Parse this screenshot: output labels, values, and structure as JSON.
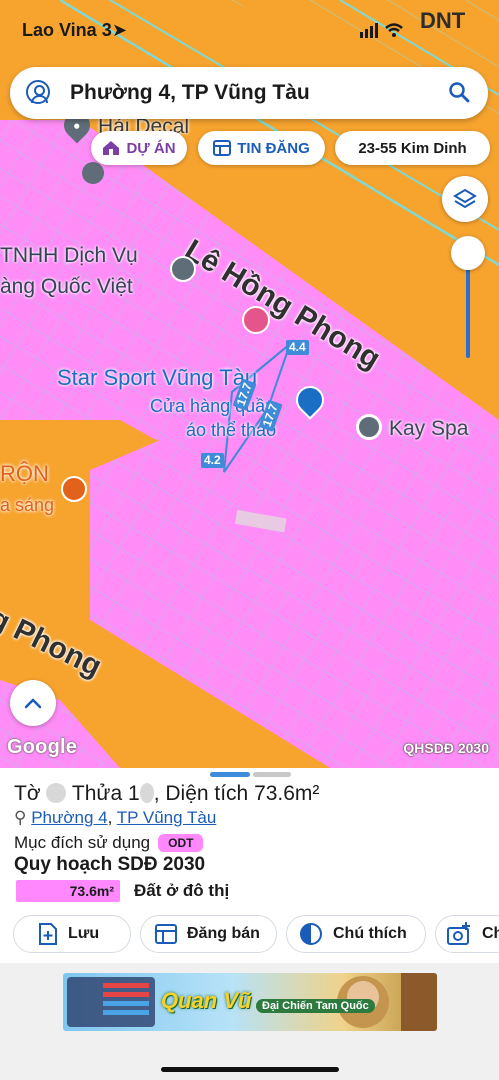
{
  "status_bar": {
    "carrier": "Lao Vina 3",
    "brand": "DNT"
  },
  "search": {
    "title": "Phường 4, TP Vũng Tàu"
  },
  "chips": {
    "project": "DỰ ÁN",
    "listing": "TIN ĐĂNG",
    "address": "23-55 Kim Dinh"
  },
  "map": {
    "road_main": "Lê Hồng Phong",
    "road_bottom": "g Phong",
    "poi_hai_decal": "Hải Decal",
    "poi_company_line1": "TNHH Dịch Vụ",
    "poi_company_line2": "àng Quốc Việt",
    "poi_star_sport": "Star Sport Vũng Tàu",
    "poi_shop_line1": "Cửa hàng quần",
    "poi_shop_line2": "áo thể thao",
    "poi_kay_spa": "Kay Spa",
    "poi_ron_line1": "RỘN",
    "poi_ron_line2": "a sáng",
    "dims": [
      "4.4",
      "17.7",
      "17.7",
      "4.2"
    ],
    "google": "Google",
    "plan_tag": "QHSDĐ 2030"
  },
  "parcel": {
    "title_prefix": "Tờ",
    "title_mid": "Thửa 1",
    "title_suffix": ", Diện tích 73.6m²",
    "ward": "Phường 4",
    "city": "TP Vũng Tàu",
    "purpose_label": "Mục đích sử dụng",
    "purpose_code": "ODT",
    "plan_title": "Quy hoạch SDĐ 2030",
    "area_value": "73.6m²",
    "area_fraction": 1.0,
    "land_type": "Đất ở đô thị"
  },
  "actions": {
    "save": "Lưu",
    "sell": "Đăng bán",
    "legend": "Chú thích",
    "more": "Ch"
  },
  "ad": {
    "brand": "Quan Vũ",
    "sub": "Đại Chiến Tam Quốc"
  },
  "colors": {
    "residential_pink": "#ff88ff",
    "road_orange": "#f7a42f",
    "accent_blue": "#1a5cb8"
  }
}
